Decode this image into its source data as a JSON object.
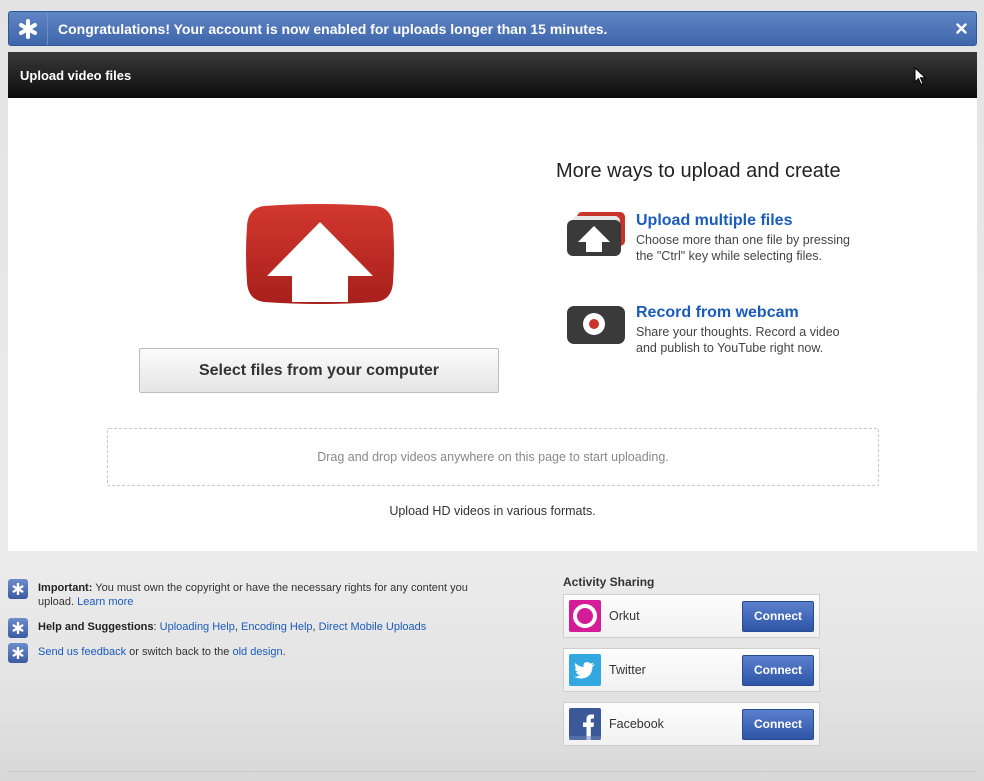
{
  "banner": {
    "message": "Congratulations! Your account is now enabled for uploads longer than 15 minutes."
  },
  "header": {
    "title": "Upload video files"
  },
  "main": {
    "select_button_label": "Select files from your computer",
    "more_ways_title": "More ways to upload and create",
    "options": [
      {
        "title": "Upload multiple files",
        "desc_line1": "Choose more than one file by pressing",
        "desc_line2": "the \"Ctrl\" key while selecting files."
      },
      {
        "title": "Record from webcam",
        "desc_line1": "Share your thoughts. Record a video",
        "desc_line2": "and publish to YouTube right now."
      }
    ],
    "dropzone_text": "Drag and drop videos anywhere on this page to start uploading.",
    "hd_note": "Upload HD videos in various formats."
  },
  "info": {
    "important_label": "Important:",
    "important_text": " You must own the copyright or have the necessary rights for any content you upload.",
    "learn_more": "Learn more",
    "help_label": "Help and Suggestions",
    "help_sep": ": ",
    "link_uploading_help": "Uploading Help",
    "link_encoding_help": "Encoding Help",
    "link_mobile_uploads": "Direct Mobile Uploads",
    "comma": ", ",
    "feedback_link": "Send us feedback",
    "switch_text": " or switch back to the ",
    "old_design_link": "old design",
    "period": "."
  },
  "activity_sharing": {
    "title": "Activity Sharing",
    "services": [
      {
        "name": "Orkut",
        "button": "Connect",
        "color": "#d41c98"
      },
      {
        "name": "Twitter",
        "button": "Connect",
        "color": "#33a7e0"
      },
      {
        "name": "Facebook",
        "button": "Connect",
        "color": "#3b5998"
      }
    ]
  },
  "colors": {
    "banner_blue": "#4a70b4",
    "link_blue": "#1a5bbd",
    "youtube_red": "#c4302b"
  }
}
